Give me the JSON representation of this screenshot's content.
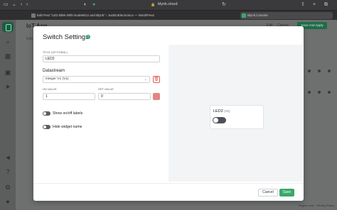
{
  "browser": {
    "url": "blynk.cloud",
    "tabs": [
      {
        "label": "Edit Post \"LED Blink With NodeMCU and Blynk\" ‹ JustDoElectronics — WordPress"
      },
      {
        "label": "Blynk.Console"
      }
    ]
  },
  "app": {
    "title": "IoT App",
    "info_label": "Info",
    "edit_label": "Edit",
    "cancel_label": "Cancel",
    "save_apply_label": "Save And Apply",
    "region": "Region: fra1 · Privacy Policy"
  },
  "modal": {
    "title": "Switch Settings",
    "help": "?",
    "title_field": {
      "label": "TITLE (OPTIONAL)",
      "value": "LED2"
    },
    "datastream": {
      "label": "Datastream",
      "selected": "Integer V1 (V1)"
    },
    "on_value": {
      "label": "ON VALUE",
      "value": "1"
    },
    "off_value": {
      "label": "OFF VALUE",
      "value": "0"
    },
    "show_onoff_label": "Show on/off labels",
    "hide_widget_name": "Hide widget name",
    "preview": {
      "name": "LED2",
      "pin": "(V1)"
    },
    "cancel": "Cancel",
    "save": "Save"
  },
  "colors": {
    "accent": "#3aa96c",
    "delete": "#e0605a",
    "swatch": "#e08784"
  }
}
